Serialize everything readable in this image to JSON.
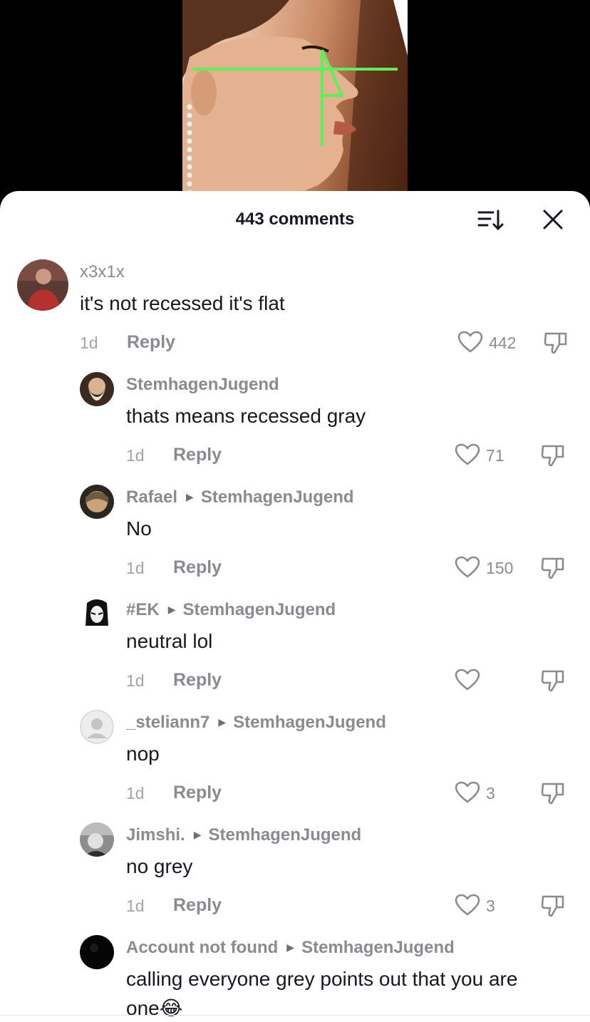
{
  "header": {
    "comment_count": "443 comments",
    "sort_icon": "sort-icon",
    "close_icon": "close-icon"
  },
  "comments": [
    {
      "user": "x3x1x",
      "text": "it's not recessed it's flat",
      "time": "1d",
      "reply_label": "Reply",
      "likes": "442"
    },
    {
      "user": "StemhagenJugend",
      "text": "thats means recessed gray",
      "time": "1d",
      "reply_label": "Reply",
      "likes": "71"
    },
    {
      "user": "Rafael",
      "reply_to": "StemhagenJugend",
      "text": "No",
      "time": "1d",
      "reply_label": "Reply",
      "likes": "150"
    },
    {
      "user": "#EK",
      "reply_to": "StemhagenJugend",
      "text": "neutral lol",
      "time": "1d",
      "reply_label": "Reply",
      "likes": ""
    },
    {
      "user": "_steliann7",
      "reply_to": "StemhagenJugend",
      "text": "nop",
      "time": "1d",
      "reply_label": "Reply",
      "likes": "3"
    },
    {
      "user": "Jimshi.",
      "reply_to": "StemhagenJugend",
      "text": "no grey",
      "time": "1d",
      "reply_label": "Reply",
      "likes": "3"
    },
    {
      "user": "Account not found",
      "reply_to": "StemhagenJugend",
      "text": "calling everyone grey points out that you are",
      "text_line2": "one😂"
    }
  ],
  "colors": {
    "sheet_bg": "#ffffff",
    "primary_text": "#161823",
    "secondary_text": "#8a8b91",
    "overlay_line": "#5ef05a"
  }
}
